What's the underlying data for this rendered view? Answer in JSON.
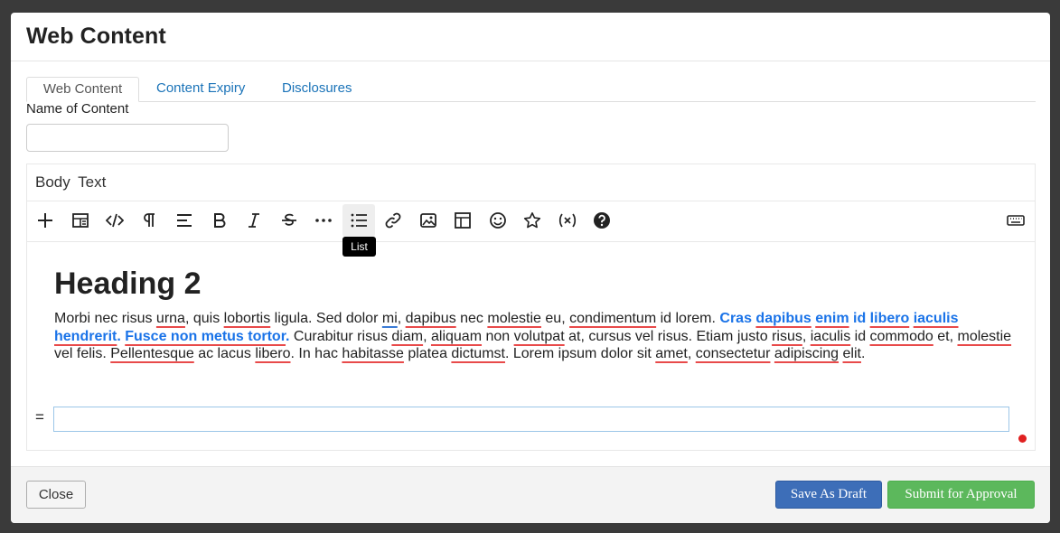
{
  "modal": {
    "title": "Web Content"
  },
  "tabs": [
    {
      "label": "Web Content",
      "active": true
    },
    {
      "label": "Content Expiry",
      "active": false
    },
    {
      "label": "Disclosures",
      "active": false
    }
  ],
  "form": {
    "name_label": "Name of Content",
    "name_value": "",
    "body_label": "Body Text"
  },
  "toolbar": {
    "items": [
      "add",
      "template",
      "source",
      "paragraph",
      "align",
      "bold",
      "italic",
      "strikethrough",
      "more",
      "list",
      "link",
      "image",
      "table",
      "emoji",
      "star",
      "variable",
      "help",
      "keyboard"
    ],
    "tooltip": "List"
  },
  "editor": {
    "heading": "Heading 2",
    "para_1": "Morbi nec risus ",
    "w_urna": "urna",
    "para_2": ", quis ",
    "w_lobortis": "lobortis",
    "para_3": " ligula. Sed dolor ",
    "w_mi": "mi",
    "para_4": ", ",
    "w_dapibus": "dapibus",
    "para_5": " nec ",
    "w_molestie": "molestie",
    "para_6": " eu, ",
    "w_condimentum": "condimentum",
    "para_7": " id lorem. ",
    "bold_1": "Cras ",
    "w_dapibus2": "dapibus",
    "bold_2": " ",
    "w_enim": "enim",
    "bold_3": " id ",
    "w_libero": "libero",
    "bold_4": " ",
    "w_iaculis": "iaculis",
    "bold_5": " ",
    "w_hendrerit": "hendrerit",
    "bold_6": ". ",
    "w_fusce": "Fusce non metus tortor",
    "bold_7": ".",
    "para_8": " Curabitur risus ",
    "w_diam": "diam",
    "para_9": ", ",
    "w_aliquam": "aliquam",
    "para_10": " non ",
    "w_volutpat": "volutpat",
    "para_11": " at, cursus vel risus. Etiam justo ",
    "w_risus": "risus",
    "para_12": ", ",
    "w_iaculis2": "iaculis",
    "para_13": " id ",
    "w_commodo": "commodo",
    "para_14": " et, ",
    "w_molestie2": "molestie",
    "para_15": " vel felis. ",
    "w_pellentesque": "Pellentesque",
    "para_16": " ac lacus ",
    "w_libero2": "libero",
    "para_17": ". In hac ",
    "w_habitasse": "habitasse",
    "para_18": " platea ",
    "w_dictumst": "dictumst",
    "para_19": ". Lorem ipsum dolor sit ",
    "w_amet": "amet",
    "para_20": ", ",
    "w_consectetur": "consectetur",
    "para_21": " ",
    "w_adipiscing": "adipiscing",
    "para_22": " ",
    "w_elit": "elit",
    "para_23": ".",
    "eq_mark": "="
  },
  "footer": {
    "close_label": "Close",
    "draft_label": "Save As Draft",
    "submit_label": "Submit for Approval"
  },
  "colors": {
    "link": "#1a73b8",
    "draft_button": "#3d6eb8",
    "submit_button": "#5cb85c",
    "spellcheck": "#e84a4a"
  }
}
